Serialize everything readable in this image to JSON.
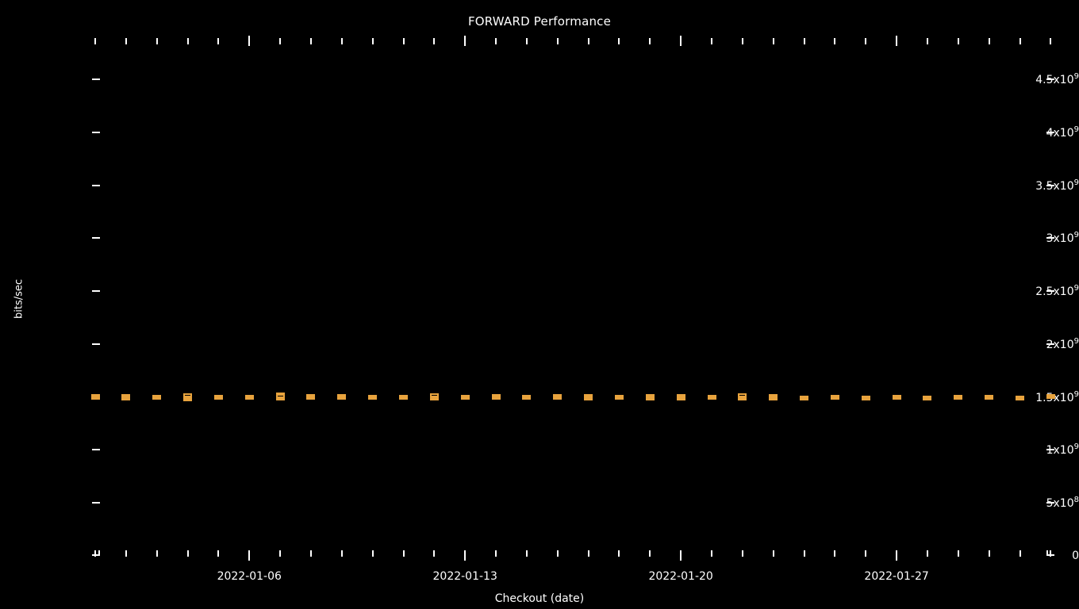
{
  "chart_data": {
    "type": "bar",
    "title": "FORWARD Performance",
    "xlabel": "Checkout (date)",
    "ylabel": "bits/sec",
    "background": "#000000",
    "series_color": "#e8a33d",
    "grid": false,
    "legend": null,
    "ylim": [
      0,
      4800000000
    ],
    "y_ticks": [
      {
        "value": 4500000000,
        "label": "4.5x10",
        "exp": "9"
      },
      {
        "value": 4000000000,
        "label": "4x10",
        "exp": "9"
      },
      {
        "value": 3500000000,
        "label": "3.5x10",
        "exp": "9"
      },
      {
        "value": 3000000000,
        "label": "3x10",
        "exp": "9"
      },
      {
        "value": 2500000000,
        "label": "2.5x10",
        "exp": "9"
      },
      {
        "value": 2000000000,
        "label": "2x10",
        "exp": "9"
      },
      {
        "value": 1500000000,
        "label": "1.5x10",
        "exp": "9"
      },
      {
        "value": 1000000000,
        "label": "1x10",
        "exp": "9"
      },
      {
        "value": 500000000,
        "label": "5x10",
        "exp": "8"
      },
      {
        "value": 0,
        "label": "0",
        "exp": ""
      }
    ],
    "x_tick_labels": [
      "2022-01-06",
      "2022-01-13",
      "2022-01-20",
      "2022-01-27"
    ],
    "x_major_indices": [
      5,
      12,
      19,
      26
    ],
    "x_minor_count": 32,
    "marker_style": "box-whisker",
    "points": [
      {
        "date": "2022-01-01",
        "low": 1478000000,
        "q1": 1492000000,
        "median": 1500000000,
        "q3": 1512000000,
        "high": 1524000000
      },
      {
        "date": "2022-01-02",
        "low": 1470000000,
        "q1": 1488000000,
        "median": 1500000000,
        "q3": 1514000000,
        "high": 1530000000
      },
      {
        "date": "2022-01-03",
        "low": 1482000000,
        "q1": 1494000000,
        "median": 1502000000,
        "q3": 1510000000,
        "high": 1520000000
      },
      {
        "date": "2022-01-04",
        "low": 1462000000,
        "q1": 1482000000,
        "median": 1496000000,
        "q3": 1512000000,
        "high": 1534000000
      },
      {
        "date": "2022-01-05",
        "low": 1476000000,
        "q1": 1488000000,
        "median": 1496000000,
        "q3": 1506000000,
        "high": 1518000000
      },
      {
        "date": "2022-01-06",
        "low": 1484000000,
        "q1": 1494000000,
        "median": 1502000000,
        "q3": 1510000000,
        "high": 1520000000
      },
      {
        "date": "2022-01-07",
        "low": 1470000000,
        "q1": 1492000000,
        "median": 1508000000,
        "q3": 1524000000,
        "high": 1544000000
      },
      {
        "date": "2022-01-08",
        "low": 1474000000,
        "q1": 1490000000,
        "median": 1502000000,
        "q3": 1514000000,
        "high": 1530000000
      },
      {
        "date": "2022-01-09",
        "low": 1472000000,
        "q1": 1488000000,
        "median": 1500000000,
        "q3": 1512000000,
        "high": 1528000000
      },
      {
        "date": "2022-01-10",
        "low": 1480000000,
        "q1": 1492000000,
        "median": 1500000000,
        "q3": 1508000000,
        "high": 1520000000
      },
      {
        "date": "2022-01-11",
        "low": 1478000000,
        "q1": 1490000000,
        "median": 1498000000,
        "q3": 1506000000,
        "high": 1518000000
      },
      {
        "date": "2022-01-12",
        "low": 1468000000,
        "q1": 1486000000,
        "median": 1500000000,
        "q3": 1514000000,
        "high": 1532000000
      },
      {
        "date": "2022-01-13",
        "low": 1476000000,
        "q1": 1488000000,
        "median": 1498000000,
        "q3": 1508000000,
        "high": 1522000000
      },
      {
        "date": "2022-01-14",
        "low": 1474000000,
        "q1": 1488000000,
        "median": 1498000000,
        "q3": 1510000000,
        "high": 1526000000
      },
      {
        "date": "2022-01-15",
        "low": 1478000000,
        "q1": 1490000000,
        "median": 1498000000,
        "q3": 1508000000,
        "high": 1520000000
      },
      {
        "date": "2022-01-16",
        "low": 1472000000,
        "q1": 1488000000,
        "median": 1500000000,
        "q3": 1512000000,
        "high": 1528000000
      },
      {
        "date": "2022-01-17",
        "low": 1466000000,
        "q1": 1484000000,
        "median": 1498000000,
        "q3": 1512000000,
        "high": 1530000000
      },
      {
        "date": "2022-01-18",
        "low": 1482000000,
        "q1": 1492000000,
        "median": 1500000000,
        "q3": 1508000000,
        "high": 1518000000
      },
      {
        "date": "2022-01-19",
        "low": 1470000000,
        "q1": 1486000000,
        "median": 1498000000,
        "q3": 1510000000,
        "high": 1526000000
      },
      {
        "date": "2022-01-20",
        "low": 1464000000,
        "q1": 1482000000,
        "median": 1496000000,
        "q3": 1510000000,
        "high": 1530000000
      },
      {
        "date": "2022-01-21",
        "low": 1474000000,
        "q1": 1488000000,
        "median": 1498000000,
        "q3": 1508000000,
        "high": 1522000000
      },
      {
        "date": "2022-01-22",
        "low": 1468000000,
        "q1": 1486000000,
        "median": 1500000000,
        "q3": 1514000000,
        "high": 1534000000
      },
      {
        "date": "2022-01-23",
        "low": 1470000000,
        "q1": 1486000000,
        "median": 1498000000,
        "q3": 1510000000,
        "high": 1526000000
      },
      {
        "date": "2022-01-24",
        "low": 1488000000,
        "q1": 1494000000,
        "median": 1498000000,
        "q3": 1504000000,
        "high": 1510000000
      },
      {
        "date": "2022-01-25",
        "low": 1478000000,
        "q1": 1490000000,
        "median": 1500000000,
        "q3": 1510000000,
        "high": 1522000000
      },
      {
        "date": "2022-01-26",
        "low": 1472000000,
        "q1": 1484000000,
        "median": 1492000000,
        "q3": 1500000000,
        "high": 1512000000
      },
      {
        "date": "2022-01-27",
        "low": 1474000000,
        "q1": 1488000000,
        "median": 1498000000,
        "q3": 1508000000,
        "high": 1522000000
      },
      {
        "date": "2022-01-28",
        "low": 1476000000,
        "q1": 1488000000,
        "median": 1496000000,
        "q3": 1504000000,
        "high": 1516000000
      },
      {
        "date": "2022-01-29",
        "low": 1482000000,
        "q1": 1492000000,
        "median": 1500000000,
        "q3": 1510000000,
        "high": 1520000000
      },
      {
        "date": "2022-01-30",
        "low": 1484000000,
        "q1": 1494000000,
        "median": 1502000000,
        "q3": 1512000000,
        "high": 1522000000
      },
      {
        "date": "2022-01-31",
        "low": 1480000000,
        "q1": 1490000000,
        "median": 1496000000,
        "q3": 1504000000,
        "high": 1514000000
      },
      {
        "date": "2022-02-01",
        "low": 1482000000,
        "q1": 1494000000,
        "median": 1502000000,
        "q3": 1512000000,
        "high": 1524000000
      }
    ]
  }
}
